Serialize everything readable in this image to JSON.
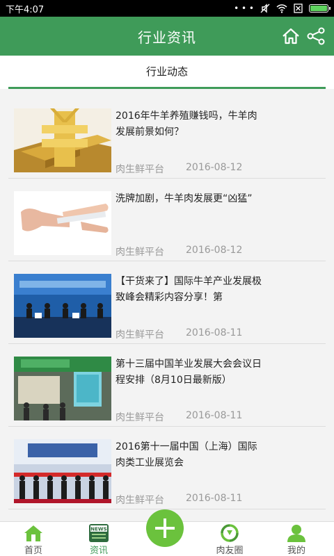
{
  "status_bar": {
    "time": "下午4:07",
    "dots": "• • •"
  },
  "header": {
    "title": "行业资讯"
  },
  "tabs": [
    {
      "label": "行业动态"
    }
  ],
  "colors": {
    "brand_green": "#3f9b59",
    "plus_green": "#6bc23d"
  },
  "articles": [
    {
      "title": "2016年牛羊养殖赚钱吗，牛羊肉发展前景如何？",
      "source": "肉生鲜平台",
      "date": "2016-08-12",
      "thumb_icon": "gold-yen-bars-image"
    },
    {
      "title": "洗牌加剧，牛羊肉发展更“凶猛”",
      "source": "肉生鲜平台",
      "date": "2016-08-12",
      "thumb_icon": "hand-holding-card-image"
    },
    {
      "title": "【干货来了】国际牛羊产业发展极致峰会精彩内容分享！第",
      "source": "肉生鲜平台",
      "date": "2016-08-11",
      "thumb_icon": "summit-stage-image"
    },
    {
      "title": "第十三届中国羊业发展大会会议日程安排（8月10日最新版）",
      "source": "肉生鲜平台",
      "date": "2016-08-11",
      "thumb_icon": "exhibition-booth-image"
    },
    {
      "title": "2016第十一届中国（上海）国际肉类工业展览会",
      "source": "肉生鲜平台",
      "date": "2016-08-11",
      "thumb_icon": "ribbon-cutting-image"
    }
  ],
  "bottom_nav": [
    {
      "label": "首页",
      "icon": "home-icon"
    },
    {
      "label": "资讯",
      "icon": "news-icon",
      "badge": "NEWS"
    },
    {
      "label": "",
      "icon": "plus-icon"
    },
    {
      "label": "肉友圈",
      "icon": "circle-arrows-icon"
    },
    {
      "label": "我的",
      "icon": "user-icon"
    }
  ]
}
